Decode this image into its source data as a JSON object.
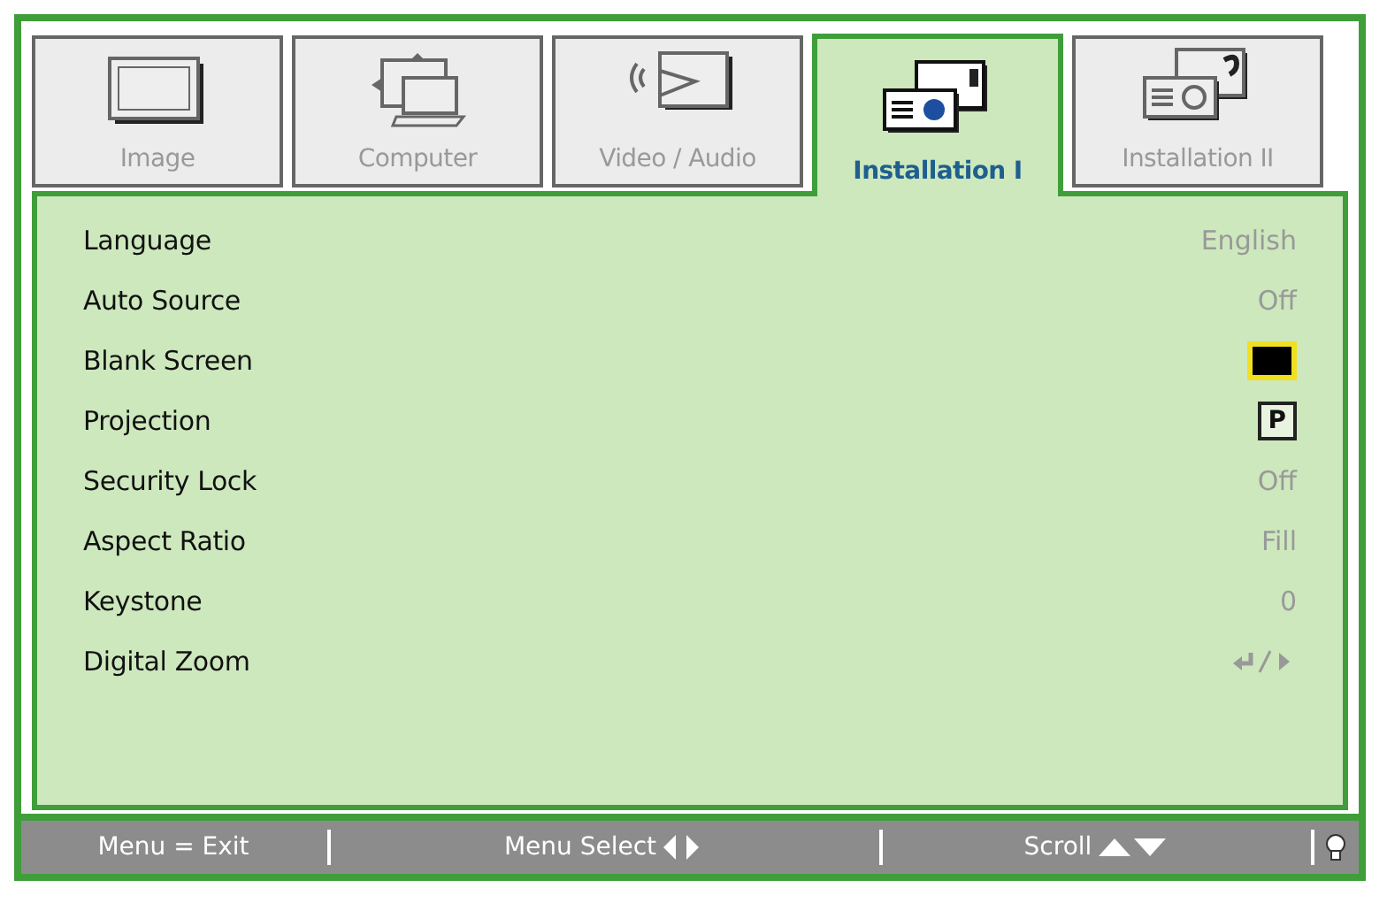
{
  "tabs": [
    {
      "label": "Image",
      "kind": "image",
      "selected": false
    },
    {
      "label": "Computer",
      "kind": "computer",
      "selected": false
    },
    {
      "label": "Video / Audio",
      "kind": "video",
      "selected": false
    },
    {
      "label": "Installation I",
      "kind": "install1",
      "selected": true
    },
    {
      "label": "Installation II",
      "kind": "install2",
      "selected": false
    }
  ],
  "settings": [
    {
      "label": "Language",
      "kind": "text",
      "value": "English"
    },
    {
      "label": "Auto Source",
      "kind": "text",
      "value": "Off"
    },
    {
      "label": "Blank Screen",
      "kind": "swatch",
      "color": "#000000"
    },
    {
      "label": "Projection",
      "kind": "boxed",
      "value": "P"
    },
    {
      "label": "Security Lock",
      "kind": "text",
      "value": "Off"
    },
    {
      "label": "Aspect Ratio",
      "kind": "text",
      "value": "Fill"
    },
    {
      "label": "Keystone",
      "kind": "text",
      "value": "0"
    },
    {
      "label": "Digital Zoom",
      "kind": "enter-arrow"
    }
  ],
  "status_bar": [
    {
      "label": "Menu = Exit",
      "kind": "text"
    },
    {
      "label": "Menu Select",
      "kind": "left-right"
    },
    {
      "label": "Scroll",
      "kind": "up-down"
    },
    {
      "kind": "bulb"
    }
  ]
}
